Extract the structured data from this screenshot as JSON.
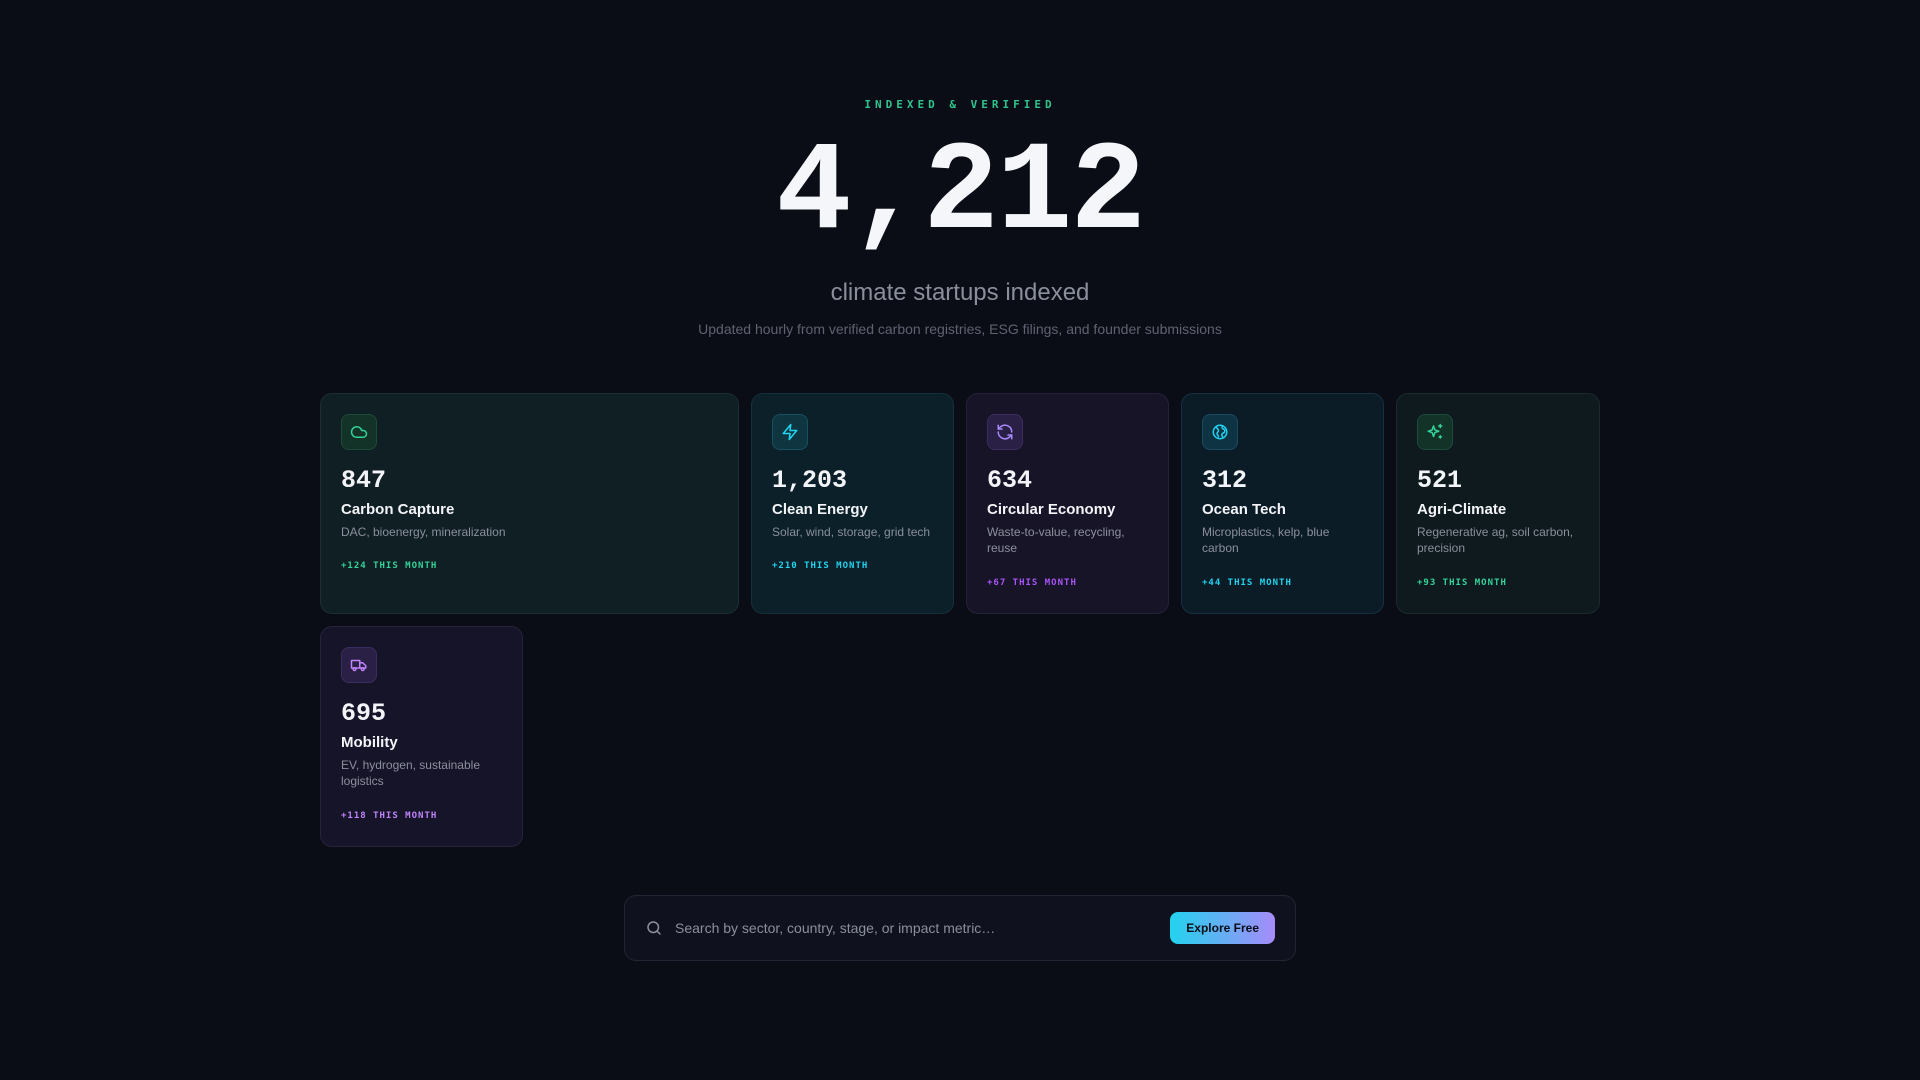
{
  "hero": {
    "eyebrow": "INDEXED & VERIFIED",
    "count": "4,212",
    "subtitle": "climate startups indexed",
    "description": "Updated hourly from verified carbon registries, ESG filings, and founder submissions"
  },
  "sectors": [
    {
      "count": "847",
      "title": "Carbon Capture",
      "desc": "DAC, bioenergy, mineralization",
      "delta": "+124 THIS MONTH",
      "icon": "cloud-icon",
      "accent": "#34d399"
    },
    {
      "count": "1,203",
      "title": "Clean Energy",
      "desc": "Solar, wind, storage, grid tech",
      "delta": "+210 THIS MONTH",
      "icon": "lightning-icon",
      "accent": "#22d3ee"
    },
    {
      "count": "634",
      "title": "Circular Economy",
      "desc": "Waste-to-value, recycling, reuse",
      "delta": "+67 THIS MONTH",
      "icon": "refresh-icon",
      "accent": "#a855f7"
    },
    {
      "count": "312",
      "title": "Ocean Tech",
      "desc": "Microplastics, kelp, blue carbon",
      "delta": "+44 THIS MONTH",
      "icon": "globe-icon",
      "accent": "#22d3ee"
    },
    {
      "count": "521",
      "title": "Agri-Climate",
      "desc": "Regenerative ag, soil carbon, precision",
      "delta": "+93 THIS MONTH",
      "icon": "sparkles-icon",
      "accent": "#34d399"
    },
    {
      "count": "695",
      "title": "Mobility",
      "desc": "EV, hydrogen, sustainable logistics",
      "delta": "+118 THIS MONTH",
      "icon": "truck-icon",
      "accent": "#c084fc"
    }
  ],
  "search": {
    "placeholder": "Search by sector, country, stage, or impact metric…",
    "button_label": "Explore Free"
  }
}
